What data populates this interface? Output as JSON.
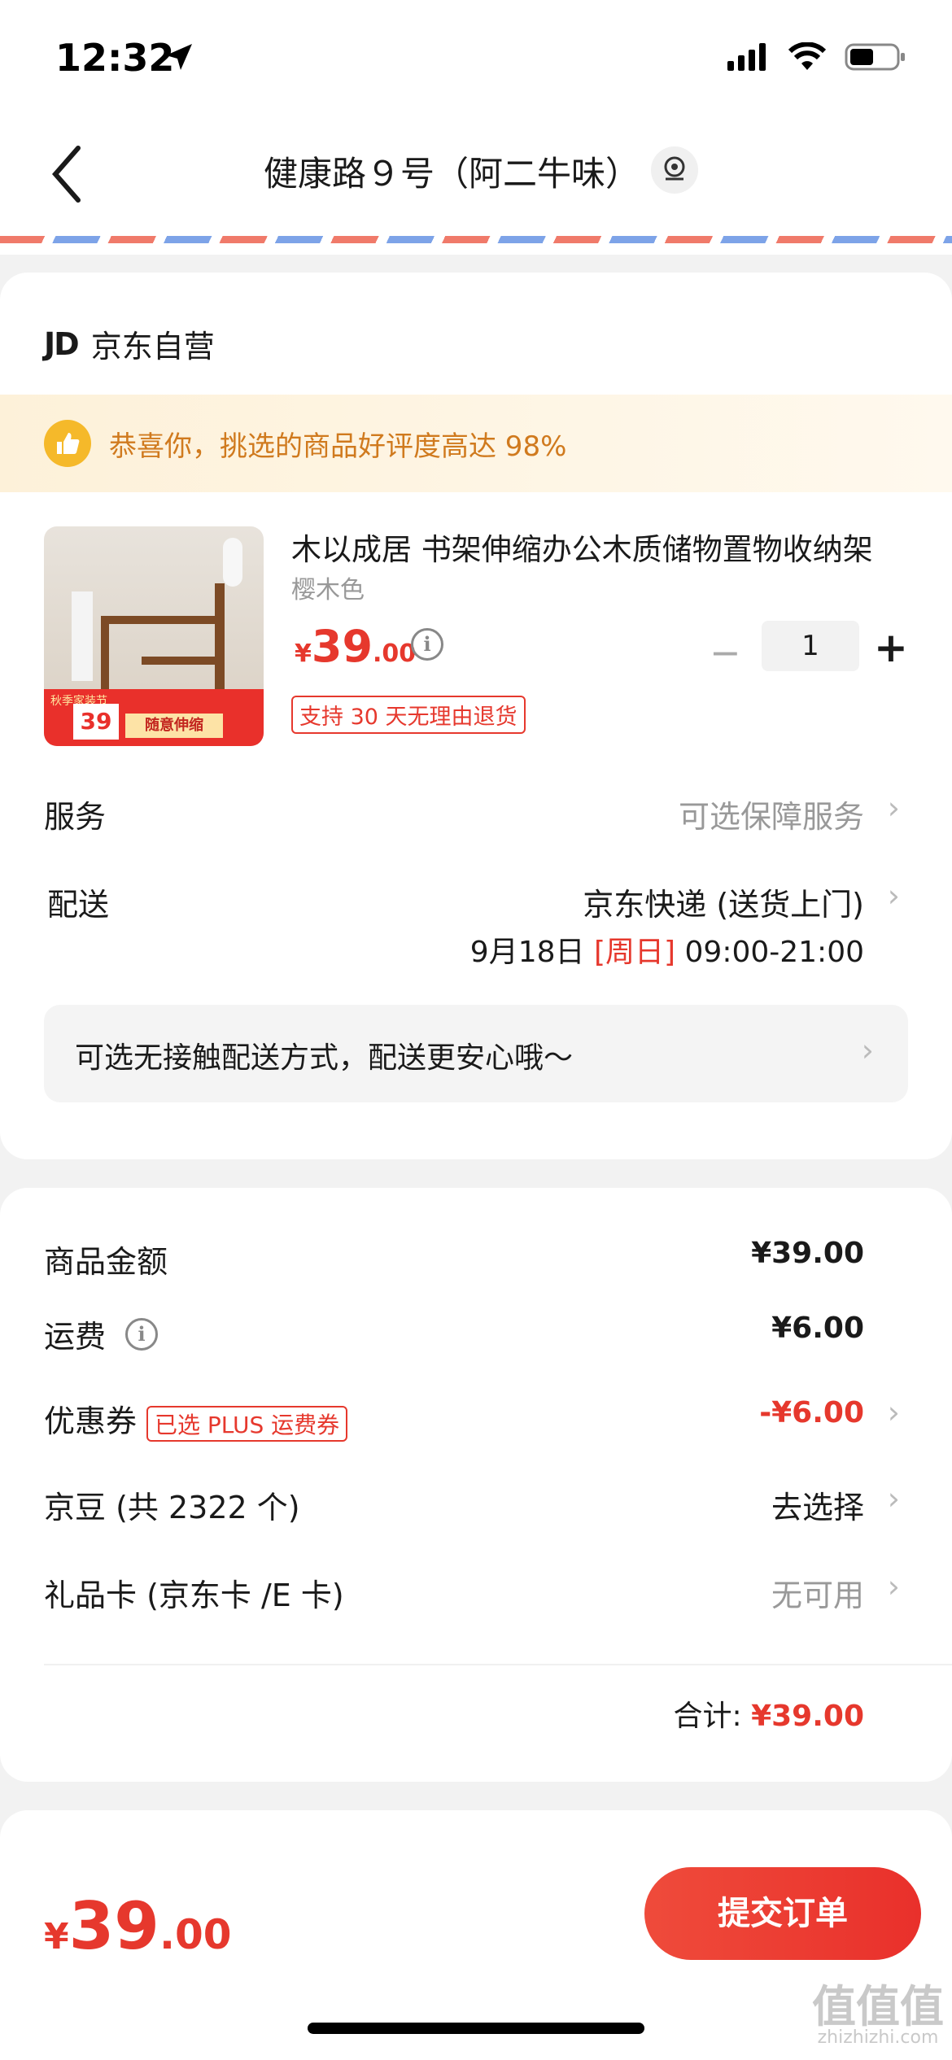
{
  "status_bar": {
    "time": "12:32"
  },
  "nav": {
    "title": "健康路９号（阿二牛味）"
  },
  "shop": {
    "logo": "JD",
    "name": "京东自营"
  },
  "banner": {
    "text": "恭喜你，挑选的商品好评度高达 98%"
  },
  "product": {
    "title": "木以成居 书架伸缩办公木质储物置物收纳架",
    "variant": "樱木色",
    "price_symbol": "¥",
    "price_int": "39",
    "price_dec": ".00",
    "quantity": "1",
    "minus": "−",
    "plus": "+",
    "return_tag": "支持 30 天无理由退货",
    "image_promo": {
      "price": "39",
      "tag": "随意伸缩",
      "top": "秋季家装节"
    }
  },
  "service": {
    "label": "服务",
    "value": "可选保障服务"
  },
  "delivery": {
    "label": "配送",
    "method": "京东快递 (送货上门)",
    "date": "9月18日",
    "weekday": "[周日]",
    "time": "09:00-21:00"
  },
  "contactless": {
    "text": "可选无接触配送方式，配送更安心哦～"
  },
  "summary": {
    "goods_label": "商品金额",
    "goods_value": "¥39.00",
    "shipping_label": "运费",
    "shipping_value": "¥6.00",
    "coupon_label": "优惠券",
    "coupon_tag": "已选 PLUS 运费券",
    "coupon_value": "-¥6.00",
    "beans_label": "京豆 (共 2322 个)",
    "beans_value": "去选择",
    "giftcard_label": "礼品卡 (京东卡 /E 卡)",
    "giftcard_value": "无可用",
    "total_label": "合计:",
    "total_value": "¥39.00"
  },
  "footer": {
    "price_symbol": "¥",
    "price_int": "39",
    "price_dec": ".00",
    "submit": "提交订单"
  },
  "watermark": {
    "text": "值值值",
    "sub": "zhizhizhi.com"
  },
  "colors": {
    "accent": "#e6382d",
    "banner_text": "#d07a1e"
  },
  "icons": [
    "location-arrow-icon",
    "signal-icon",
    "wifi-icon",
    "battery-icon",
    "back-icon",
    "location-pin-icon",
    "thumbs-up-icon",
    "info-icon",
    "chevron-right-icon"
  ]
}
